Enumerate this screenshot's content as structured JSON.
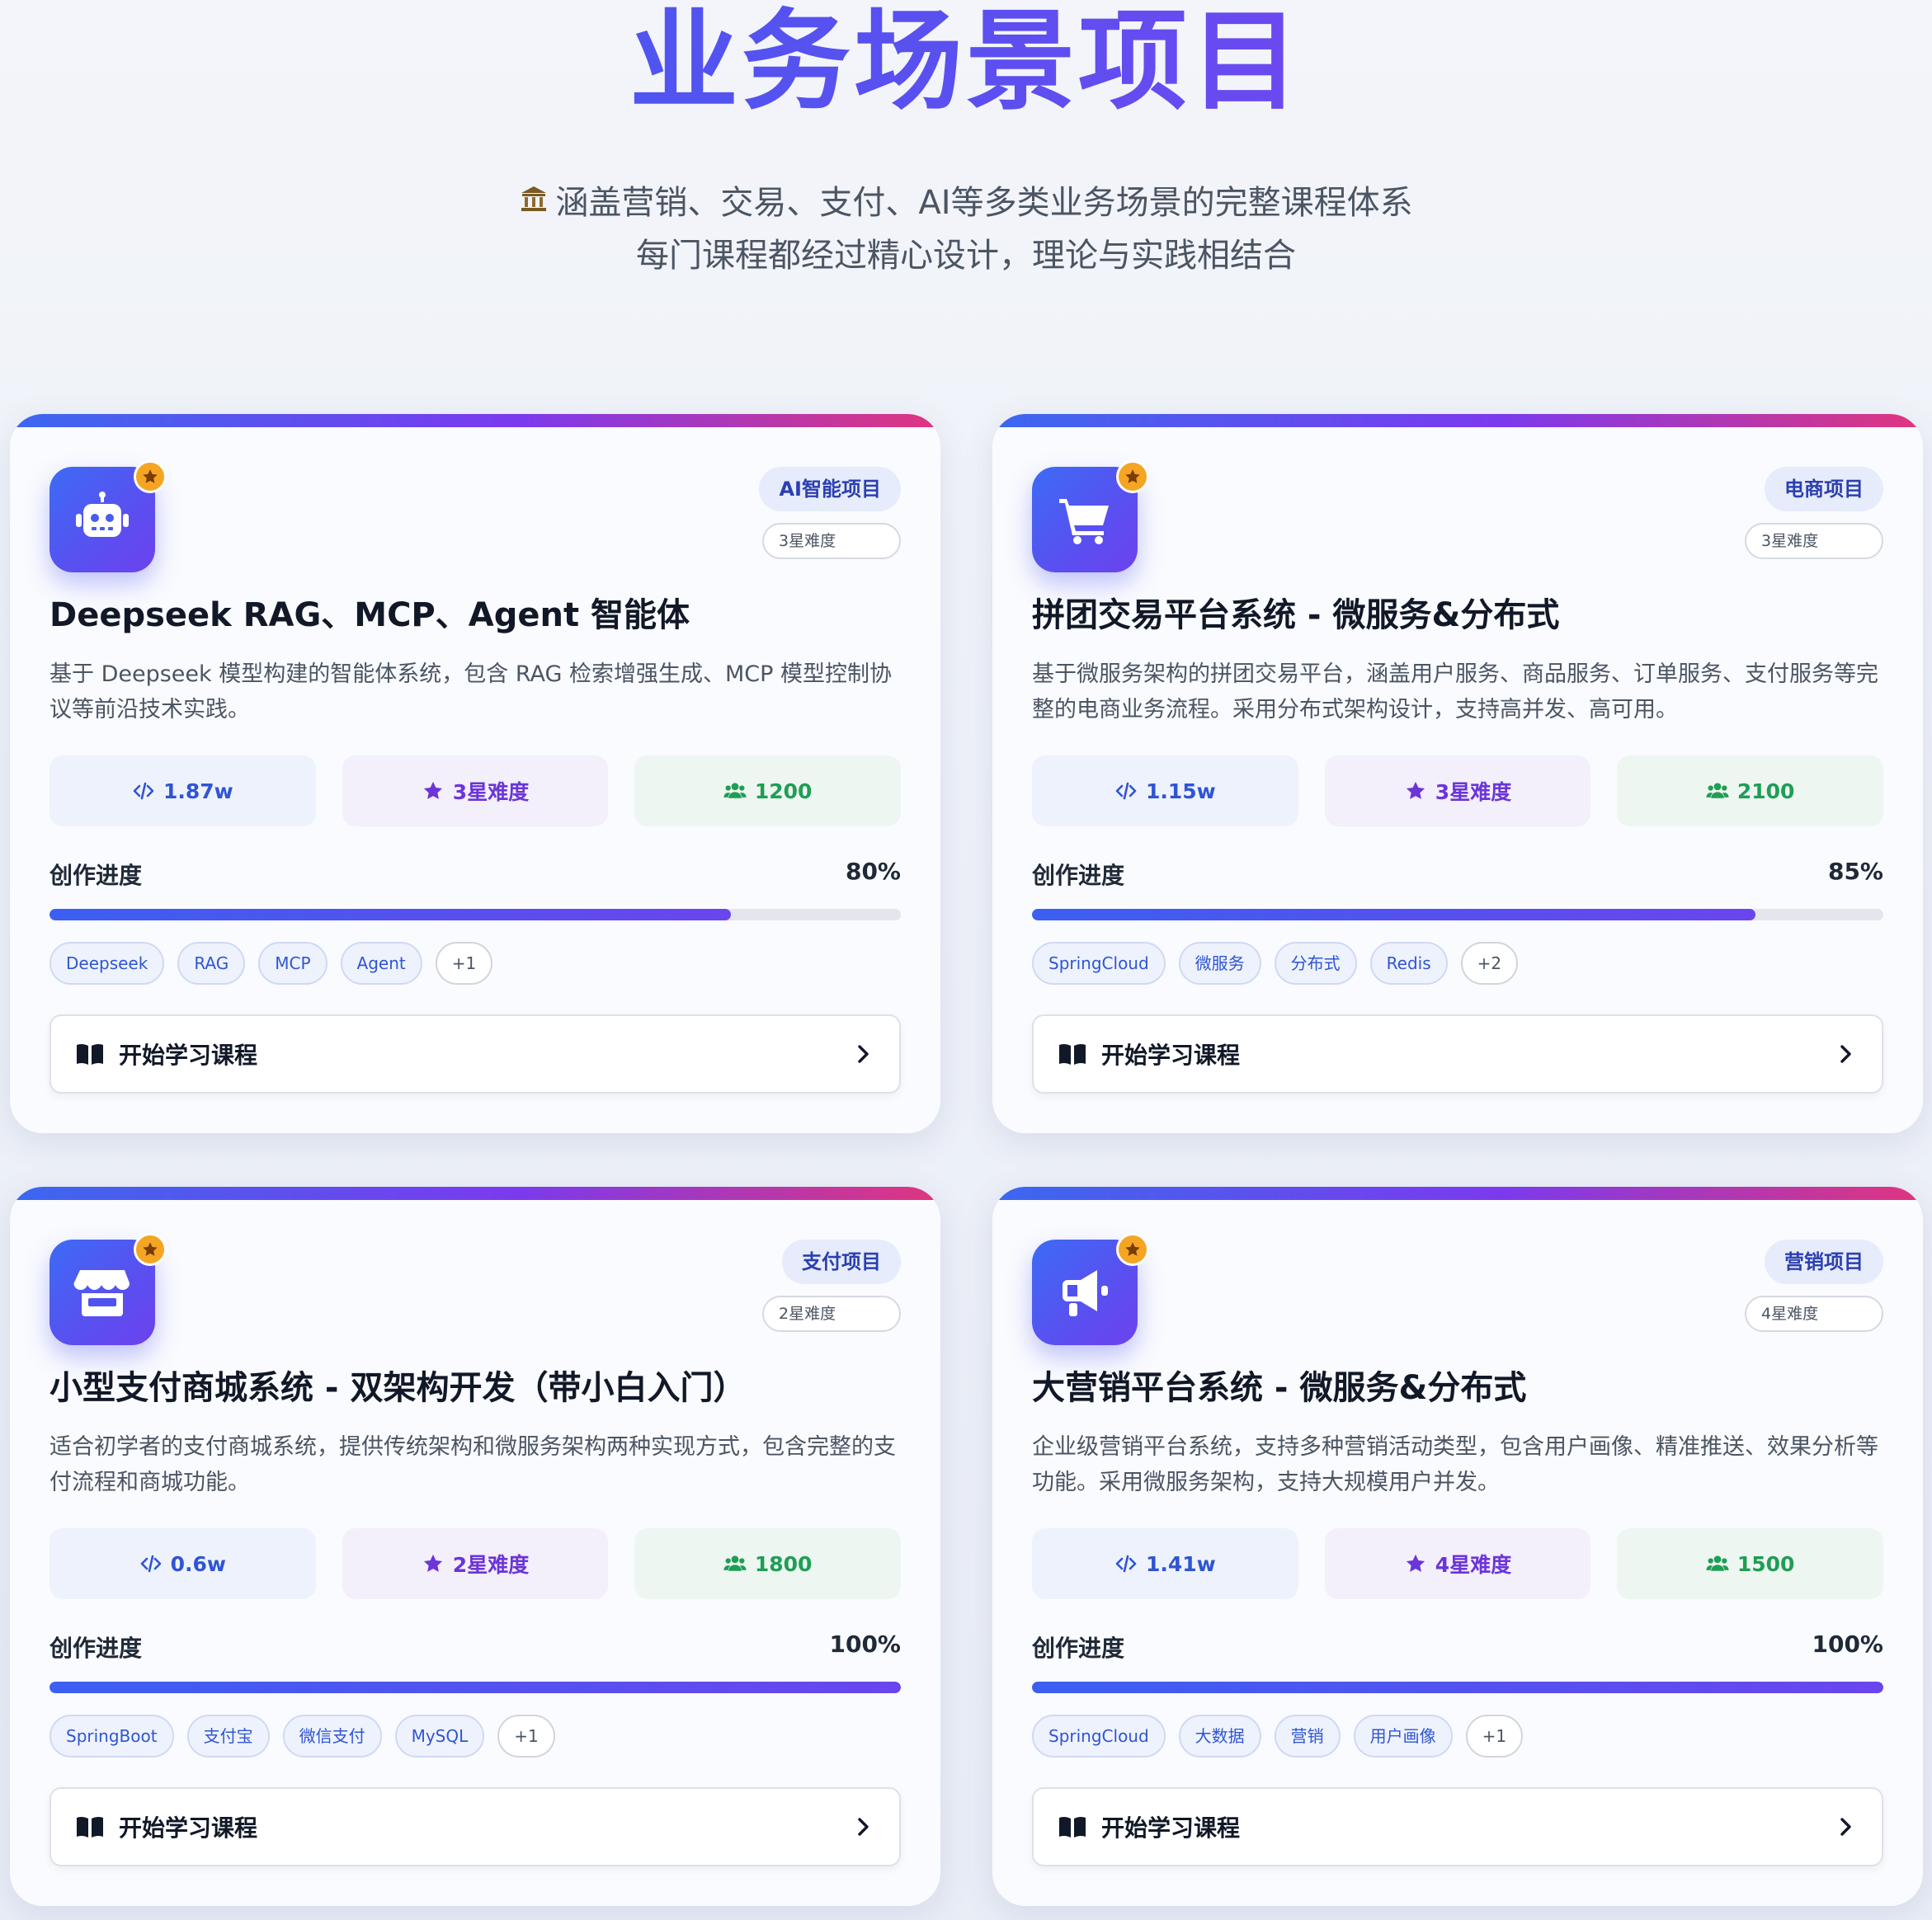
{
  "hero": {
    "title": "业务场景项目",
    "subtitle_icon": "bank-icon",
    "subtitle_line1": "涵盖营销、交易、支付、AI等多类业务场景的完整课程体系",
    "subtitle_line2": "每门课程都经过精心设计，理论与实践相结合"
  },
  "colors": {
    "accent_blue": "#3b5ff2",
    "accent_purple": "#7c3aed",
    "accent_pink": "#e0357f",
    "star_gold": "#f5a524",
    "users_green": "#1f9e55"
  },
  "cta_label": "开始学习课程",
  "progress_label": "创作进度",
  "cards": [
    {
      "icon": "robot-icon",
      "category": "AI智能项目",
      "difficulty_badge": "3星难度",
      "title": "Deepseek RAG、MCP、Agent 智能体",
      "description": "基于 Deepseek 模型构建的智能体系统，包含 RAG 检索增强生成、MCP 模型控制协议等前沿技术实践。",
      "stats": {
        "views": "1.87w",
        "level": "3星难度",
        "users": "1200"
      },
      "progress_text": "80%",
      "progress": 0.8,
      "tags": [
        "Deepseek",
        "RAG",
        "MCP",
        "Agent"
      ],
      "more_tags": "+1"
    },
    {
      "icon": "shopping-cart-icon",
      "category": "电商项目",
      "difficulty_badge": "3星难度",
      "title": "拼团交易平台系统 - 微服务&分布式",
      "description": "基于微服务架构的拼团交易平台，涵盖用户服务、商品服务、订单服务、支付服务等完整的电商业务流程。采用分布式架构设计，支持高并发、高可用。",
      "stats": {
        "views": "1.15w",
        "level": "3星难度",
        "users": "2100"
      },
      "progress_text": "85%",
      "progress": 0.85,
      "tags": [
        "SpringCloud",
        "微服务",
        "分布式",
        "Redis"
      ],
      "more_tags": "+2"
    },
    {
      "icon": "store-icon",
      "category": "支付项目",
      "difficulty_badge": "2星难度",
      "title": "小型支付商城系统 - 双架构开发（带小白入门）",
      "description": "适合初学者的支付商城系统，提供传统架构和微服务架构两种实现方式，包含完整的支付流程和商城功能。",
      "stats": {
        "views": "0.6w",
        "level": "2星难度",
        "users": "1800"
      },
      "progress_text": "100%",
      "progress": 1.0,
      "tags": [
        "SpringBoot",
        "支付宝",
        "微信支付",
        "MySQL"
      ],
      "more_tags": "+1"
    },
    {
      "icon": "megaphone-icon",
      "category": "营销项目",
      "difficulty_badge": "4星难度",
      "title": "大营销平台系统 - 微服务&分布式",
      "description": "企业级营销平台系统，支持多种营销活动类型，包含用户画像、精准推送、效果分析等功能。采用微服务架构，支持大规模用户并发。",
      "stats": {
        "views": "1.41w",
        "level": "4星难度",
        "users": "1500"
      },
      "progress_text": "100%",
      "progress": 1.0,
      "tags": [
        "SpringCloud",
        "大数据",
        "营销",
        "用户画像"
      ],
      "more_tags": "+1"
    }
  ]
}
